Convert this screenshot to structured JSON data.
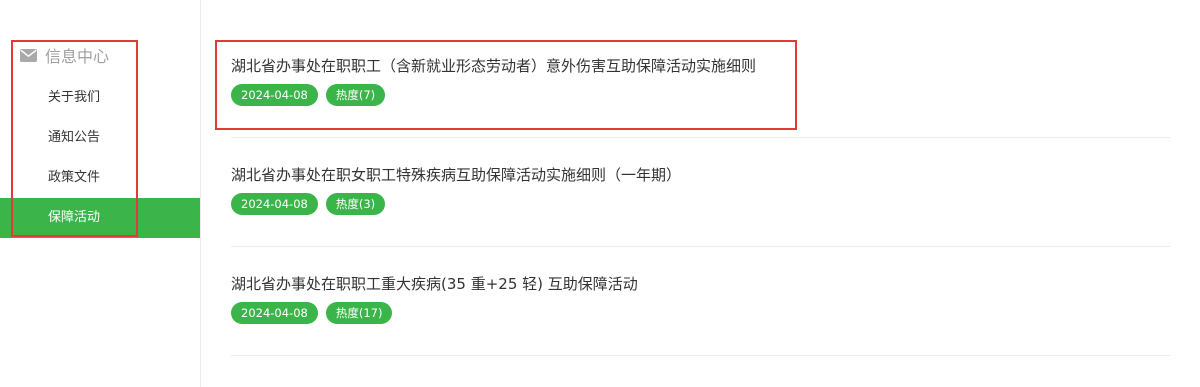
{
  "sidebar": {
    "header": "信息中心",
    "items": [
      {
        "label": "关于我们",
        "active": false
      },
      {
        "label": "通知公告",
        "active": false
      },
      {
        "label": "政策文件",
        "active": false
      },
      {
        "label": "保障活动",
        "active": true
      }
    ]
  },
  "articles": [
    {
      "title": "湖北省办事处在职职工（含新就业形态劳动者）意外伤害互助保障活动实施细则",
      "date": "2024-04-08",
      "heat": "热度(7)"
    },
    {
      "title": "湖北省办事处在职女职工特殊疾病互助保障活动实施细则（一年期）",
      "date": "2024-04-08",
      "heat": "热度(3)"
    },
    {
      "title": "湖北省办事处在职职工重大疾病(35 重+25 轻) 互助保障活动",
      "date": "2024-04-08",
      "heat": "热度(17)"
    }
  ],
  "colors": {
    "accent": "#3bb54a",
    "highlight": "#e23a3a",
    "muted": "#a0a0a0"
  },
  "icons": {
    "sidebar_header": "envelope-icon"
  }
}
